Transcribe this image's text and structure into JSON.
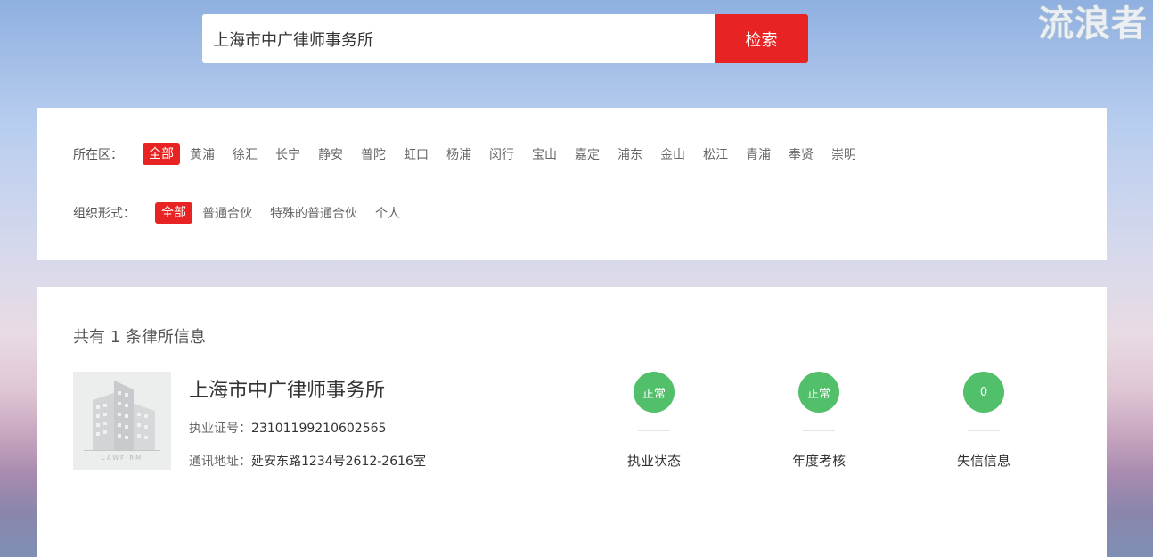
{
  "watermark": "流浪者",
  "search": {
    "value": "上海市中广律师事务所",
    "button_label": "检索"
  },
  "filters": {
    "district": {
      "label": "所在区：",
      "selected": "全部",
      "options": [
        "黄浦",
        "徐汇",
        "长宁",
        "静安",
        "普陀",
        "虹口",
        "杨浦",
        "闵行",
        "宝山",
        "嘉定",
        "浦东",
        "金山",
        "松江",
        "青浦",
        "奉贤",
        "崇明"
      ]
    },
    "org_type": {
      "label": "组织形式：",
      "selected": "全部",
      "options": [
        "普通合伙",
        "特殊的普通合伙",
        "个人"
      ]
    }
  },
  "results": {
    "count_text": "共有 1 条律所信息",
    "items": [
      {
        "thumb_caption": "LAWFIRM",
        "name": "上海市中广律师事务所",
        "license_label": "执业证号：",
        "license_value": "23101199210602565",
        "address_label": "通讯地址：",
        "address_value": "延安东路1234号2612-2616室",
        "stats": [
          {
            "value": "正常",
            "label": "执业状态"
          },
          {
            "value": "正常",
            "label": "年度考核"
          },
          {
            "value": "0",
            "label": "失信信息"
          }
        ]
      }
    ]
  },
  "colors": {
    "accent": "#e82323",
    "status_green": "#52bf6b"
  }
}
